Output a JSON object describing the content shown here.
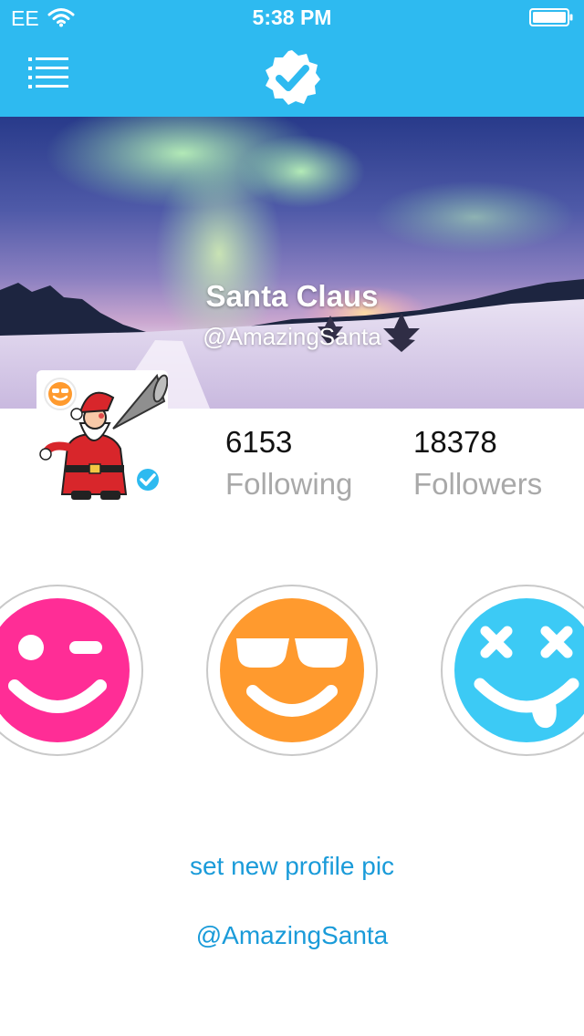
{
  "status_bar": {
    "carrier": "EE",
    "time": "5:38 PM"
  },
  "nav": {
    "menu_icon": "menu-icon",
    "logo_icon": "verified-badge-icon",
    "accent_color": "#2ebaf0"
  },
  "profile": {
    "name": "Santa Claus",
    "handle": "@AmazingSanta",
    "stats": [
      {
        "value": "6153",
        "label": "Following"
      },
      {
        "value": "18378",
        "label": "Followers"
      }
    ]
  },
  "emojis": [
    {
      "name": "wink-emoji-icon",
      "color": "#ff2d96"
    },
    {
      "name": "sunglasses-emoji-icon",
      "color": "#ff9a2e"
    },
    {
      "name": "tongue-out-emoji-icon",
      "color": "#3ccaf5"
    }
  ],
  "actions": {
    "set_profile_pic": "set new profile pic",
    "handle_link": "@AmazingSanta",
    "link_color": "#1a9bd9"
  }
}
